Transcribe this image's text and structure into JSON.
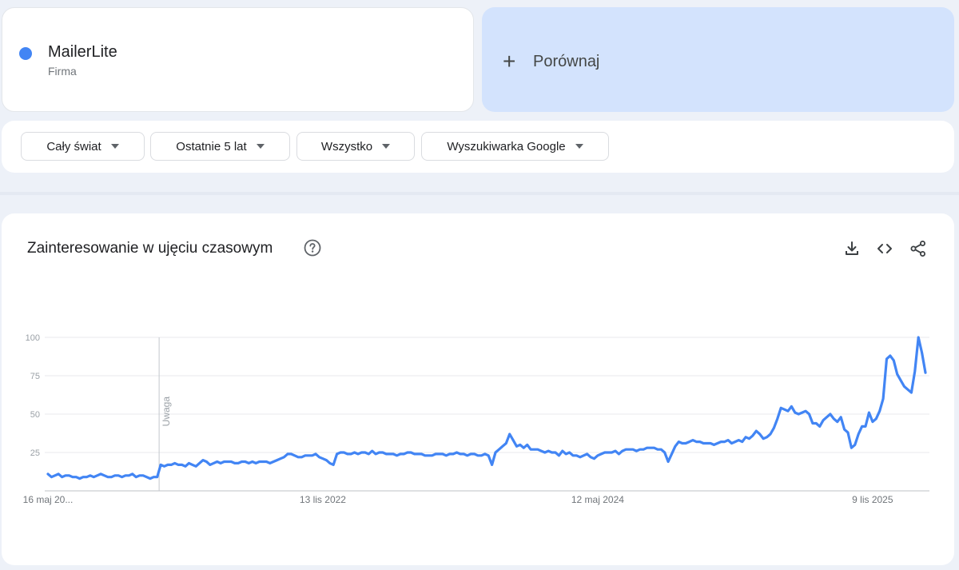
{
  "term": {
    "name": "MailerLite",
    "type": "Firma"
  },
  "compare": {
    "label": "Porównaj"
  },
  "filters": {
    "region": "Cały świat",
    "time": "Ostatnie 5 lat",
    "category": "Wszystko",
    "property": "Wyszukiwarka Google"
  },
  "colors": {
    "series": "#4285f4",
    "compare_bg": "#d3e3fd"
  },
  "chart_title": "Zainteresowanie w ujęciu czasowym",
  "chart_data": {
    "type": "line",
    "title": "Zainteresowanie w ujęciu czasowym",
    "xlabel": "",
    "ylabel": "",
    "ylim": [
      0,
      100
    ],
    "yticks": [
      25,
      50,
      75,
      100
    ],
    "grid": true,
    "x_tick_labels": [
      {
        "index": 0,
        "label": "16 maj 20..."
      },
      {
        "index": 78,
        "label": "13 lis 2022"
      },
      {
        "index": 156,
        "label": "12 maj 2024"
      },
      {
        "index": 234,
        "label": "9 lis 2025"
      }
    ],
    "annotation": {
      "index": 32,
      "label": "Uwaga"
    },
    "partial_from_index": 263,
    "series": [
      {
        "values": [
          11,
          9,
          10,
          11,
          9,
          10,
          10,
          9,
          9,
          8,
          9,
          9,
          10,
          9,
          10,
          11,
          10,
          9,
          9,
          10,
          10,
          9,
          10,
          10,
          11,
          9,
          10,
          10,
          9,
          8,
          9,
          9,
          17,
          16,
          17,
          17,
          18,
          17,
          17,
          16,
          18,
          17,
          16,
          18,
          20,
          19,
          17,
          18,
          19,
          18,
          19,
          19,
          19,
          18,
          18,
          19,
          19,
          18,
          19,
          18,
          19,
          19,
          19,
          18,
          19,
          20,
          21,
          22,
          24,
          24,
          23,
          22,
          22,
          23,
          23,
          23,
          24,
          22,
          21,
          20,
          18,
          17,
          24,
          25,
          25,
          24,
          24,
          25,
          24,
          25,
          25,
          24,
          26,
          24,
          25,
          25,
          24,
          24,
          24,
          23,
          24,
          24,
          25,
          25,
          24,
          24,
          24,
          23,
          23,
          23,
          24,
          24,
          24,
          23,
          24,
          24,
          25,
          24,
          24,
          23,
          24,
          24,
          23,
          23,
          24,
          23,
          17,
          25,
          27,
          29,
          31,
          37,
          33,
          29,
          30,
          28,
          30,
          27,
          27,
          27,
          26,
          25,
          26,
          25,
          25,
          23,
          26,
          24,
          25,
          23,
          23,
          22,
          23,
          24,
          22,
          21,
          23,
          24,
          25,
          25,
          25,
          26,
          24,
          26,
          27,
          27,
          27,
          26,
          27,
          27,
          28,
          28,
          28,
          27,
          27,
          25,
          19,
          24,
          29,
          32,
          31,
          31,
          32,
          33,
          32,
          32,
          31,
          31,
          31,
          30,
          31,
          32,
          32,
          33,
          31,
          32,
          33,
          32,
          35,
          34,
          36,
          39,
          37,
          34,
          35,
          37,
          41,
          47,
          54,
          53,
          52,
          55,
          51,
          50,
          51,
          52,
          50,
          44,
          44,
          42,
          46,
          48,
          50,
          47,
          45,
          48,
          40,
          38,
          28,
          30,
          37,
          42,
          42,
          51,
          45,
          47,
          52,
          60,
          86,
          88,
          85,
          76,
          72,
          68,
          66,
          64,
          78,
          100,
          90,
          77
        ]
      }
    ]
  }
}
